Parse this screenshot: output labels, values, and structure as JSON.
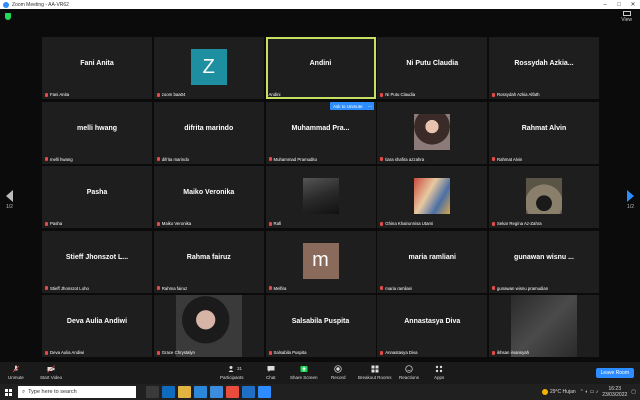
{
  "window": {
    "title": "Zoom Meeting - AA-VR62"
  },
  "top": {
    "view_label": "View"
  },
  "pager": {
    "left": "1/2",
    "right": "1/2"
  },
  "ask_unmute": {
    "label": "Ask to Unmute",
    "more": "..."
  },
  "tiles": [
    {
      "big": "Fani Anita",
      "label": "Fani Anita",
      "type": "name"
    },
    {
      "avatar": "Z",
      "label": "zoom baa04",
      "type": "avatar",
      "color": "#1e8fa0"
    },
    {
      "big": "Andini",
      "label": "Andini",
      "type": "active"
    },
    {
      "big": "Ni Putu Claudia",
      "label": "Ni Putu Claudia",
      "type": "name"
    },
    {
      "big": "Rossydah  Azkia...",
      "label": "Rossydah Azkia Alfath",
      "type": "name"
    },
    {
      "big": "melli hwang",
      "label": "melli hwang",
      "type": "name"
    },
    {
      "big": "difrita marindo",
      "label": "difrita marindo",
      "type": "name"
    },
    {
      "big": "Muhammad  Pra...",
      "label": "Muhammad Pramudito",
      "type": "name"
    },
    {
      "label": "tiara shafira azzahra",
      "type": "photo"
    },
    {
      "big": "Rahmat Alvin",
      "label": "Rahmat Alvin",
      "type": "name"
    },
    {
      "big": "Pasha",
      "label": "Pasha",
      "type": "name"
    },
    {
      "big": "Maiko Veronika",
      "label": "Maiko Veronika",
      "type": "name"
    },
    {
      "label": "Rafi",
      "type": "photo"
    },
    {
      "label": "Ghina Khairunnisa Utami",
      "type": "photo"
    },
    {
      "label": "Sekar Regina Az-Zahra",
      "type": "photo"
    },
    {
      "big": "Stieff  Jhonszot  L...",
      "label": "Stieff Jhonszot Loho",
      "type": "name"
    },
    {
      "big": "Rahma fairuz",
      "label": "Rahma fairuz",
      "type": "name"
    },
    {
      "avatar": "m",
      "label": "Melfira",
      "type": "avatar",
      "color": "#8a6a5a"
    },
    {
      "big": "maria ramliani",
      "label": "maria ramliani",
      "type": "name"
    },
    {
      "big": "gunawan  wisnu ...",
      "label": "gunawan wisnu pramudian",
      "type": "name"
    },
    {
      "big": "Deva Aulia Andiwi",
      "label": "Deva Aulia Andiwi",
      "type": "name"
    },
    {
      "label": "Grace Chrystalyn",
      "type": "photo"
    },
    {
      "big": "Salsabila Puspita",
      "label": "Salsabila Puspita",
      "type": "name"
    },
    {
      "big": "Annastasya Diva",
      "label": "Annastasya Diva",
      "type": "name"
    },
    {
      "label": "ikhsan irvansyah",
      "type": "photo"
    }
  ],
  "toolbar": {
    "unmute": "Unmute",
    "start_video": "Start Video",
    "participants": "Participants",
    "participants_count": "31",
    "chat": "Chat",
    "share_screen": "Share Screen",
    "record": "Record",
    "breakout": "Breakout Rooms",
    "reactions": "Reactions",
    "apps": "Apps",
    "leave": "Leave Room"
  },
  "taskbar": {
    "search_placeholder": "Type here to search",
    "weather": "29°C  Hujan",
    "time": "16:23",
    "date": "23/03/2022"
  },
  "colors": {
    "accent": "#2d8cff",
    "active_border": "#c5e063",
    "tile_bg": "#1e1e1e",
    "share_green": "#23d959"
  }
}
